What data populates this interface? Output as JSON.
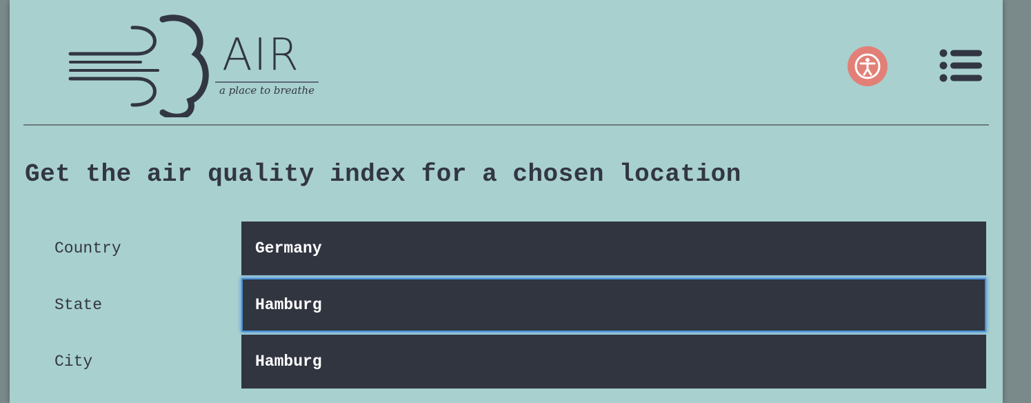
{
  "header": {
    "logo": {
      "title": "AIR",
      "tagline": "a place to breathe"
    },
    "accessibility_icon": "accessibility-icon",
    "menu_icon": "list-menu-icon"
  },
  "colors": {
    "background": "#a8d0cf",
    "text": "#323643",
    "field_background": "#313540",
    "field_text": "#ffffff",
    "accessibility_button": "#e28078",
    "focus_ring": "#4a8fd6"
  },
  "main": {
    "heading": "Get the air quality index for a chosen location",
    "form": {
      "country": {
        "label": "Country",
        "value": "Germany"
      },
      "state": {
        "label": "State",
        "value": "Hamburg"
      },
      "city": {
        "label": "City",
        "value": "Hamburg"
      }
    }
  }
}
